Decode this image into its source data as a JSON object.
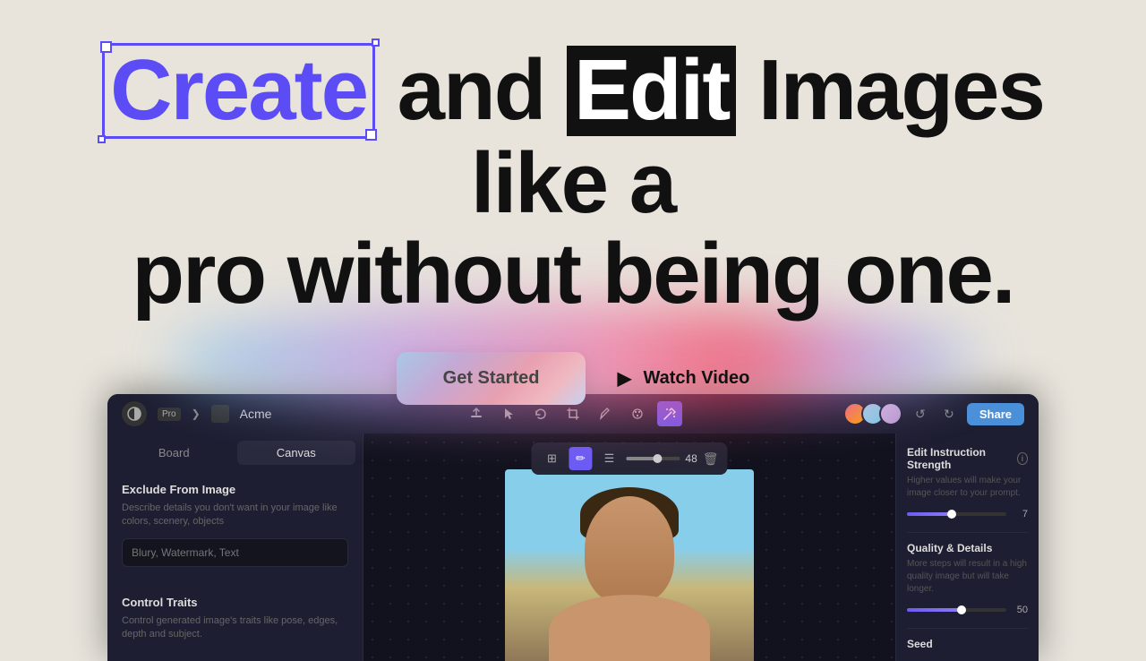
{
  "hero": {
    "headline_part1": "Create",
    "headline_and": " and ",
    "headline_edit": "Edit",
    "headline_rest": " Images like a",
    "headline_line2": "pro without being one.",
    "cta_primary": "Get Started",
    "cta_secondary": "Watch Video"
  },
  "app": {
    "project_name": "Acme",
    "share_label": "Share",
    "tabs": {
      "board": "Board",
      "canvas": "Canvas"
    },
    "sidebar": {
      "exclude_title": "Exclude From Image",
      "exclude_desc": "Describe details you don't want in your image like colors, scenery, objects",
      "exclude_placeholder": "Blury, Watermark, Text",
      "control_title": "Control Traits",
      "control_desc": "Control generated image's traits like pose, edges, depth and subject."
    },
    "right_panel": {
      "edit_strength_title": "Edit Instruction Strength",
      "edit_strength_desc": "Higher values will make your image closer to your prompt.",
      "edit_strength_value": "7",
      "quality_title": "Quality & Details",
      "quality_desc": "More steps will result in a high quality image but will take longer.",
      "quality_value": "50",
      "seed_label": "Seed"
    },
    "mini_toolbar": {
      "value": "48"
    }
  }
}
